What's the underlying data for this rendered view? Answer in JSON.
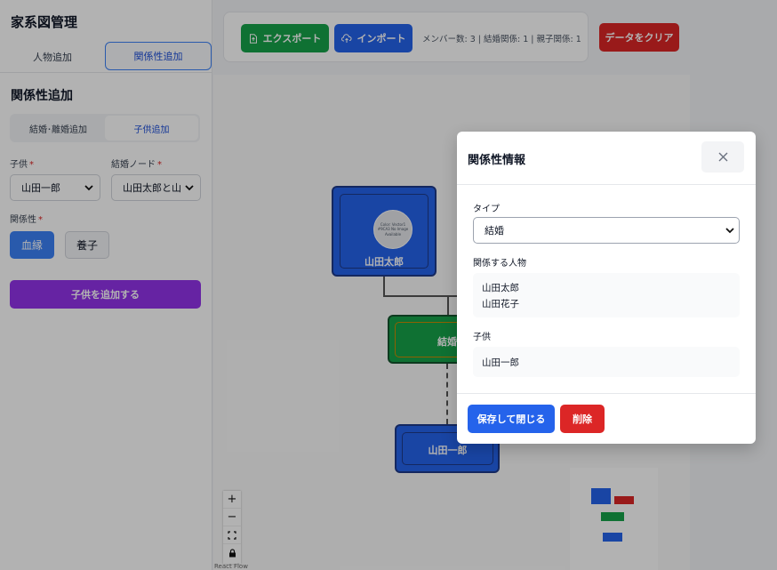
{
  "app": {
    "title": "家系図管理"
  },
  "sidebar": {
    "tabs": [
      {
        "label": "人物追加"
      },
      {
        "label": "関係性追加"
      }
    ],
    "section_title": "関係性追加",
    "subtabs": [
      {
        "label": "結婚･離婚追加"
      },
      {
        "label": "子供追加"
      }
    ],
    "child_label": "子供",
    "child_value": "山田一郎",
    "marriage_label": "結婚ノード",
    "marriage_value": "山田太郎と山",
    "relation_label": "関係性",
    "relation_options": [
      {
        "label": "血縁"
      },
      {
        "label": "養子"
      }
    ],
    "add_child_button": "子供を追加する",
    "required_mark": "*"
  },
  "toolbar": {
    "export_label": "エクスポート",
    "import_label": "インポート",
    "stats": "メンバー数: 3 | 結婚関係: 1 | 親子関係: 1",
    "clear_label": "データをクリア"
  },
  "canvas": {
    "person_node_name": "山田太郎",
    "avatar_text": "Color: Vector1 #9CA3 No Image Available",
    "marriage_node_label": "結婚",
    "child_node_name": "山田一郎",
    "controls": {
      "zoom_in": "+",
      "zoom_out": "−",
      "fit": "⛶",
      "lock": "🔒"
    },
    "attribution": "React Flow"
  },
  "modal": {
    "title": "関係性情報",
    "type_label": "タイプ",
    "type_value": "結婚",
    "related_label": "関係する人物",
    "related_people": [
      "山田太郎",
      "山田花子"
    ],
    "children_label": "子供",
    "children": [
      "山田一郎"
    ],
    "save_label": "保存して閉じる",
    "delete_label": "削除"
  },
  "colors": {
    "export": "#16a34a",
    "import": "#2563eb",
    "clear": "#dc2626",
    "add_child": "#9333ea",
    "person_node": "#2563eb",
    "marriage_node": "#16a34a"
  }
}
